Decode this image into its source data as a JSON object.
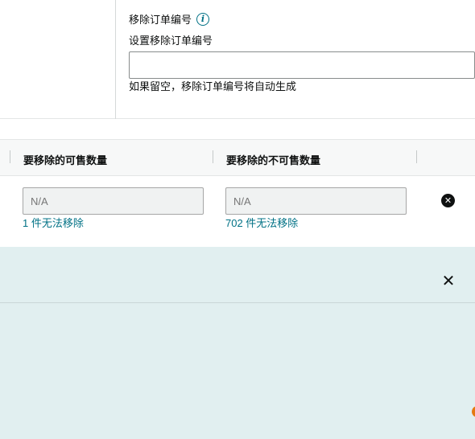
{
  "order": {
    "title": "移除订单编号",
    "info_icon": "i",
    "subtitle": "设置移除订单编号",
    "input_value": "",
    "input_placeholder": "",
    "hint": "如果留空，移除订单编号将自动生成"
  },
  "table": {
    "headers": [
      "要移除的可售数量",
      "要移除的不可售数量"
    ]
  },
  "row": {
    "sellable_placeholder": "N/A",
    "sellable_note": "1 件无法移除",
    "unsellable_placeholder": "N/A",
    "unsellable_note": "702 件无法移除",
    "remove_icon": "✕"
  },
  "panel": {
    "close_icon": "✕"
  },
  "colors": {
    "link": "#007185",
    "panel_bg": "#e1eff0",
    "header_bg": "#f7f8f8"
  }
}
